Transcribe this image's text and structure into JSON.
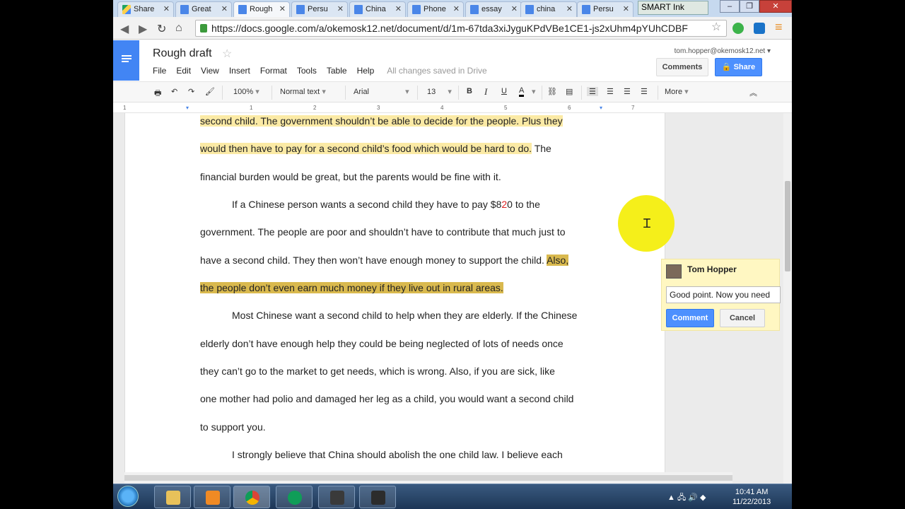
{
  "browser": {
    "tabs": [
      {
        "label": "Share",
        "icon": "drive-icon"
      },
      {
        "label": "Great",
        "icon": "docs-icon"
      },
      {
        "label": "Rough",
        "icon": "docs-icon",
        "active": true
      },
      {
        "label": "Persu",
        "icon": "docs-icon"
      },
      {
        "label": "China",
        "icon": "docs-icon"
      },
      {
        "label": "Phone",
        "icon": "docs-icon"
      },
      {
        "label": "essay",
        "icon": "docs-icon"
      },
      {
        "label": "china",
        "icon": "docs-icon"
      },
      {
        "label": "Persu",
        "icon": "docs-icon"
      }
    ],
    "smart_ink": "SMART Ink",
    "url": "https://docs.google.com/a/okemosk12.net/document/d/1m-67tda3xiJyguKPdVBe1CE1-js2xUhm4pYUhCDBF"
  },
  "docs": {
    "title": "Rough draft",
    "menu": [
      "File",
      "Edit",
      "View",
      "Insert",
      "Format",
      "Tools",
      "Table",
      "Help"
    ],
    "save_status": "All changes saved in Drive",
    "user_email": "tom.hopper@okemosk12.net",
    "comments_label": "Comments",
    "share_label": "Share",
    "accent": "#4d90fe"
  },
  "toolbar": {
    "zoom": "100%",
    "style": "Normal text",
    "font": "Arial",
    "size": "13",
    "bold": "B",
    "italic": "I",
    "underline": "U",
    "text_color": "A",
    "more": "More"
  },
  "ruler": [
    "1",
    "1",
    "2",
    "3",
    "4",
    "5",
    "6",
    "7"
  ],
  "document": {
    "lines": [
      {
        "parts": [
          {
            "text": "second child. The government shouldn’t be able to decide for the people. Plus they",
            "hl": "light"
          }
        ]
      },
      {
        "parts": [
          {
            "text": "would then have to pay for a second child’s food which would be hard to do.",
            "hl": "light"
          },
          {
            "text": " The",
            "hl": ""
          }
        ]
      },
      {
        "parts": [
          {
            "text": "financial burden would be great, but the parents would be fine with it.",
            "hl": ""
          }
        ]
      },
      {
        "parts": [
          {
            "text": "If a Chinese person wants a second child they have to pay $8",
            "hl": ""
          },
          {
            "text": "2",
            "hl": "red"
          },
          {
            "text": "0 to the",
            "hl": ""
          }
        ]
      },
      {
        "parts": [
          {
            "text": "government. The people are poor and shouldn’t have to contribute that much just to",
            "hl": ""
          }
        ]
      },
      {
        "parts": [
          {
            "text": "have a second child. They then won’t have enough money to support the child. ",
            "hl": ""
          },
          {
            "text": "Also,",
            "hl": "dark"
          }
        ]
      },
      {
        "parts": [
          {
            "text": "the people don’t even earn much money if they live out in rural areas.",
            "hl": "dark"
          }
        ]
      },
      {
        "parts": [
          {
            "text": "Most Chinese want a second child to help when they are elderly. If the Chinese",
            "hl": ""
          }
        ]
      },
      {
        "parts": [
          {
            "text": "elderly don’t have enough help they could be being neglected of lots of needs once",
            "hl": ""
          }
        ]
      },
      {
        "parts": [
          {
            "text": "they can’t go to the market to get needs, which is wrong. Also, if you are sick, like",
            "hl": ""
          }
        ]
      },
      {
        "parts": [
          {
            "text": "one mother had polio and damaged her leg as a child, you would want a second child",
            "hl": ""
          }
        ]
      },
      {
        "parts": [
          {
            "text": "to support you.",
            "hl": ""
          }
        ]
      },
      {
        "parts": [
          {
            "text": "I strongly believe that China should abolish the one child law. I believe each",
            "hl": ""
          }
        ]
      }
    ]
  },
  "comment": {
    "author": "Tom Hopper",
    "draft": "Good point. Now you need",
    "submit_label": "Comment",
    "cancel_label": "Cancel"
  },
  "taskbar": {
    "time": "10:41 AM",
    "date": "11/22/2013",
    "apps": [
      "explorer-icon",
      "media-player-icon",
      "chrome-icon",
      "hangouts-icon",
      "smart-notebook-icon",
      "smart-ink-icon"
    ]
  }
}
